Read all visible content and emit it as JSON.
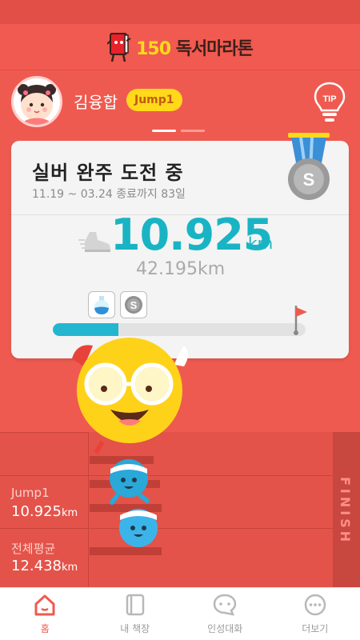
{
  "app": {
    "logo_number": "150",
    "logo_text": "독서마라톤"
  },
  "profile": {
    "name": "김융합",
    "level": "Jump1",
    "tip_label": "TIP"
  },
  "card": {
    "title": "실버 완주 도전 중",
    "period": "11.19 ~ 03.24 종료까지 83일",
    "distance": "10.925",
    "distance_unit": "km",
    "goal": "42.195km",
    "medal_letter": "S",
    "progress_fraction": 0.259,
    "bubble_letter": "S"
  },
  "stats": [
    {
      "label": "Jump1",
      "value": "10.925",
      "unit": "km"
    },
    {
      "label": "전체평균",
      "value": "12.438",
      "unit": "km"
    }
  ],
  "finish_label": "FINISH",
  "tabs": [
    {
      "label": "홈",
      "icon": "home-icon",
      "active": true
    },
    {
      "label": "내 책장",
      "icon": "bookshelf-icon",
      "active": false
    },
    {
      "label": "인성대화",
      "icon": "chat-icon",
      "active": false
    },
    {
      "label": "더보기",
      "icon": "more-icon",
      "active": false
    }
  ],
  "colors": {
    "primary": "#ef5a50",
    "accent": "#19b4c4",
    "badge": "#ffd91a"
  }
}
